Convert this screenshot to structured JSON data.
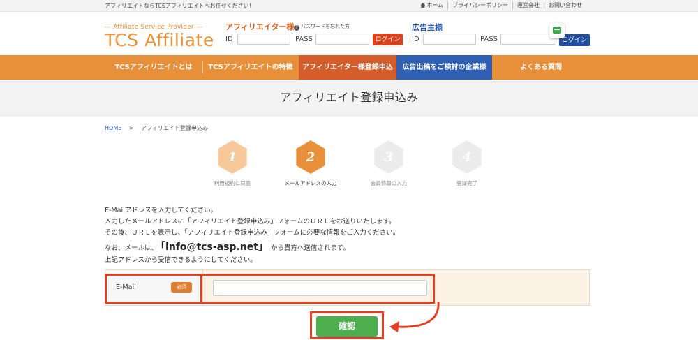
{
  "topbar": {
    "tagline": "アフィリエイトならTCSアフィリエイトへお任せください！",
    "links": [
      "ホーム",
      "プライバシーポリシー",
      "運営会社",
      "お問い合わせ"
    ]
  },
  "logo": {
    "sub": "― Affiliate Service Provider ―",
    "main": "TCS Affiliate"
  },
  "affiliate_login": {
    "title": "アフィリエイター様",
    "forgot": "パスワードを忘れた方",
    "id_label": "ID",
    "pass_label": "PASS",
    "button": "ログイン"
  },
  "advertiser_login": {
    "title": "広告主様",
    "id_label": "ID",
    "pass_label": "PASS",
    "button": "ログイン"
  },
  "nav": [
    "TCSアフィリエイトとは",
    "TCSアフィリエイトの特徴",
    "アフィリエイター様登録申込",
    "広告出稿をご検討の企業様",
    "よくある質問"
  ],
  "page_title": "アフィリエイト登録申込み",
  "breadcrumb": {
    "home": "HOME",
    "separator": ">",
    "current": "アフィリエイト登録申込み"
  },
  "steps": [
    {
      "num": "1",
      "label": "利用規約に同意",
      "color": "#f6c89a"
    },
    {
      "num": "2",
      "label": "メールアドレスの入力",
      "color": "#e8913a"
    },
    {
      "num": "3",
      "label": "会員情報の入力",
      "color": "#ececec"
    },
    {
      "num": "4",
      "label": "登録完了",
      "color": "#ececec"
    }
  ],
  "instructions": {
    "line1": "E-Mailアドレスを入力してください。",
    "line2": "入力したメールアドレスに「アフィリエイト登録申込み」フォームのＵＲＬをお送りいたします。",
    "line3": "その後、ＵＲＬを表示し、「アフィリエイト登録申込み」フォームに必要な情報をご入力ください。",
    "line4_pre": "なお、メールは、",
    "line4_mail": "「info@tcs-asp.net」",
    "line4_post": "から貴方へ送信されます。",
    "line5": "上記アドレスから受信できるようにしてください。"
  },
  "form": {
    "email_label": "E-Mail",
    "required": "必須",
    "email_value": ""
  },
  "confirm_button": "確認",
  "colors": {
    "orange": "#e88f3a",
    "active_tab": "#d45d2a",
    "blue_tab": "#2e5fb3",
    "highlight": "#e43e23",
    "confirm": "#4cae4c"
  }
}
